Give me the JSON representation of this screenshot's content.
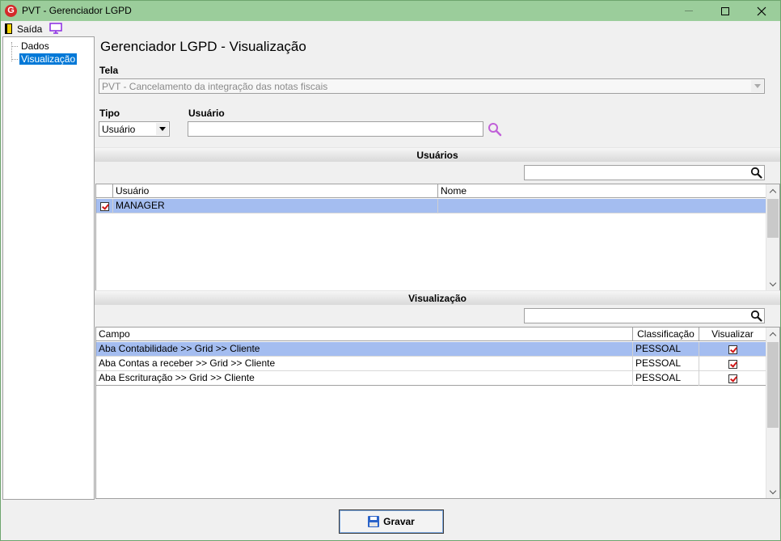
{
  "window": {
    "title": "PVT - Gerenciador LGPD",
    "icon_letter": "G"
  },
  "toolbar": {
    "exit_label": "Saída"
  },
  "tree": {
    "items": [
      {
        "label": "Dados"
      },
      {
        "label": "Visualização",
        "selected": true
      }
    ]
  },
  "page": {
    "title": "Gerenciador LGPD - Visualização"
  },
  "form": {
    "tela_label": "Tela",
    "tela_value": "PVT - Cancelamento da integração das notas fiscais",
    "tipo_label": "Tipo",
    "tipo_value": "Usuário",
    "usuario_label": "Usuário",
    "usuario_value": ""
  },
  "usuarios_section": {
    "header": "Usuários",
    "search_value": "",
    "columns": [
      "Usuário",
      "Nome"
    ],
    "rows": [
      {
        "checked": true,
        "usuario": "MANAGER",
        "nome": ""
      }
    ]
  },
  "visualizacao_section": {
    "header": "Visualização",
    "search_value": "",
    "columns": [
      "Campo",
      "Classificação",
      "Visualizar"
    ],
    "rows": [
      {
        "campo": "Aba Contabilidade >> Grid >> Cliente",
        "classificacao": "PESSOAL",
        "visualizar": true
      },
      {
        "campo": "Aba Contas a receber >> Grid >> Cliente",
        "classificacao": "PESSOAL",
        "visualizar": true
      },
      {
        "campo": "Aba Escrituração >> Grid >> Cliente",
        "classificacao": "PESSOAL",
        "visualizar": true
      }
    ]
  },
  "buttons": {
    "save_label": "Gravar"
  },
  "colors": {
    "titlebar": "#9bcd9b",
    "selected_row": "#a4bdf0",
    "tree_selected": "#0078d7",
    "check_mark": "#d01818"
  }
}
